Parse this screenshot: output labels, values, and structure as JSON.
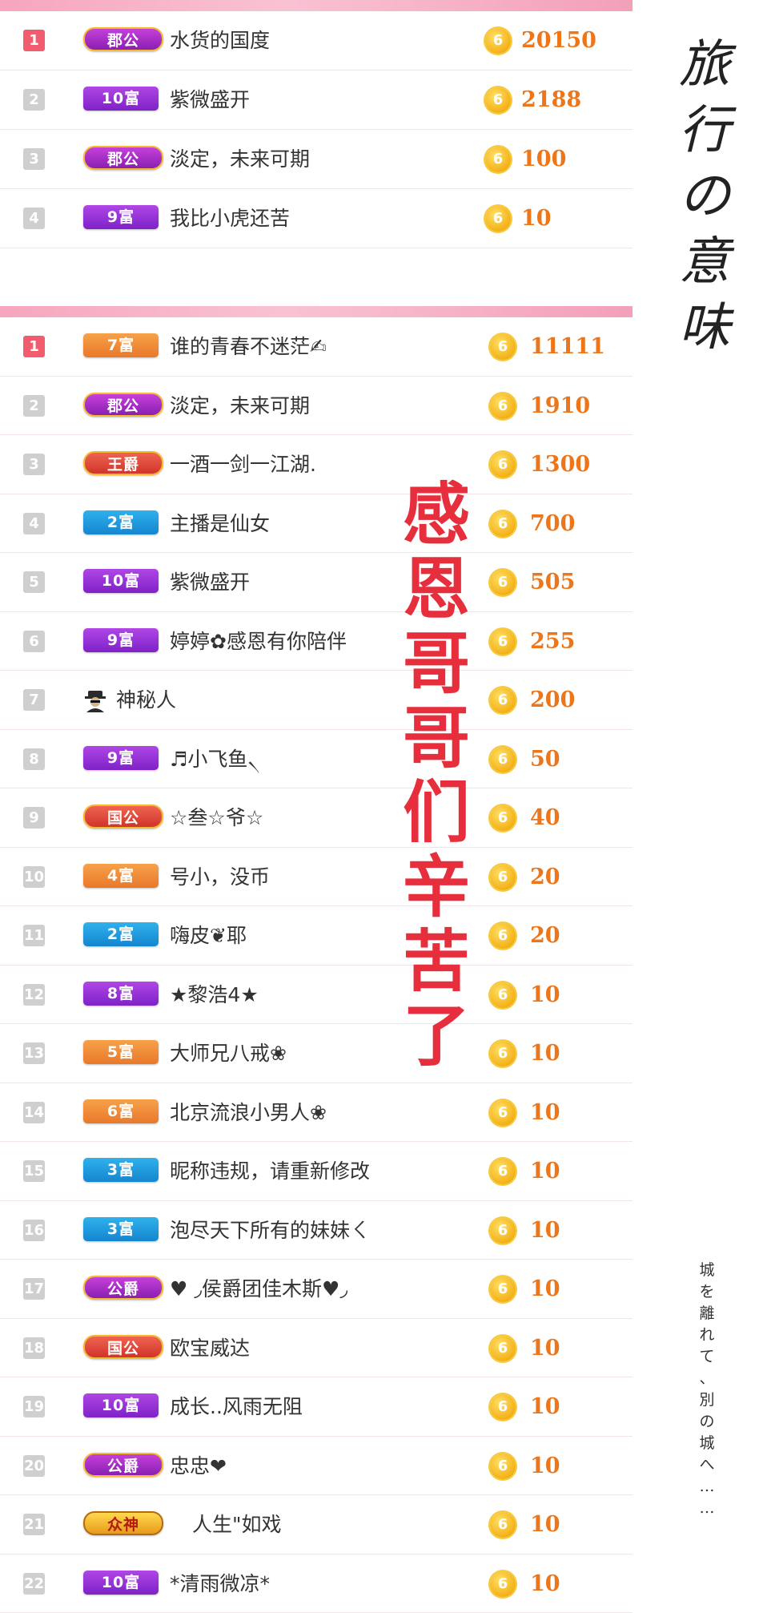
{
  "top_list": [
    {
      "rank": "1",
      "badge": "郡公",
      "badge_style": "b-magenta",
      "wide": true,
      "name": "水货的国度",
      "coin": "6",
      "amount": "20150",
      "first": true
    },
    {
      "rank": "2",
      "badge": "10富",
      "badge_style": "b-purple",
      "wide": false,
      "name": "紫微盛开",
      "coin": "6",
      "amount": "2188"
    },
    {
      "rank": "3",
      "badge": "郡公",
      "badge_style": "b-magenta",
      "wide": true,
      "name": "淡定，未来可期",
      "coin": "6",
      "amount": "100"
    },
    {
      "rank": "4",
      "badge": "9富",
      "badge_style": "b-purple",
      "wide": false,
      "name": "我比小虎还苦",
      "coin": "6",
      "amount": "10"
    }
  ],
  "bottom_list": [
    {
      "rank": "1",
      "badge": "7富",
      "badge_style": "b-orange",
      "name": "谁的青春不迷茫✍",
      "coin": "6",
      "amount": "11111",
      "first": true
    },
    {
      "rank": "2",
      "badge": "郡公",
      "badge_style": "b-magenta",
      "wide": true,
      "name": "淡定，未来可期",
      "coin": "6",
      "amount": "1910"
    },
    {
      "rank": "3",
      "badge": "王爵",
      "badge_style": "b-red",
      "wide": true,
      "name": "一酒一剑一江湖.",
      "coin": "6",
      "amount": "1300"
    },
    {
      "rank": "4",
      "badge": "2富",
      "badge_style": "b-blue",
      "name": "主播是仙女",
      "coin": "6",
      "amount": "700"
    },
    {
      "rank": "5",
      "badge": "10富",
      "badge_style": "b-purple",
      "name": "紫微盛开",
      "coin": "6",
      "amount": "505"
    },
    {
      "rank": "6",
      "badge": "9富",
      "badge_style": "b-purple",
      "name": "婷婷✿感恩有你陪伴",
      "coin": "6",
      "amount": "255"
    },
    {
      "rank": "7",
      "badge": "",
      "mystery": true,
      "name": "神秘人",
      "coin": "6",
      "amount": "200"
    },
    {
      "rank": "8",
      "badge": "9富",
      "badge_style": "b-purple",
      "name": "♬小飞鱼৲",
      "coin": "6",
      "amount": "50"
    },
    {
      "rank": "9",
      "badge": "国公",
      "badge_style": "b-red",
      "wide": true,
      "name": "☆叁☆爷☆",
      "coin": "6",
      "amount": "40"
    },
    {
      "rank": "10",
      "badge": "4富",
      "badge_style": "b-orange",
      "name": "号小，没币",
      "coin": "6",
      "amount": "20"
    },
    {
      "rank": "11",
      "badge": "2富",
      "badge_style": "b-blue",
      "name": "嗨皮❦耶",
      "coin": "6",
      "amount": "20"
    },
    {
      "rank": "12",
      "badge": "8富",
      "badge_style": "b-purple",
      "name": "★黎浩4★",
      "coin": "6",
      "amount": "10"
    },
    {
      "rank": "13",
      "badge": "5富",
      "badge_style": "b-orange",
      "name": "大师兄八戒❀",
      "coin": "6",
      "amount": "10"
    },
    {
      "rank": "14",
      "badge": "6富",
      "badge_style": "b-orange",
      "name": "北京流浪小男人❀",
      "coin": "6",
      "amount": "10"
    },
    {
      "rank": "15",
      "badge": "3富",
      "badge_style": "b-blue",
      "name": "昵称违规，请重新修改",
      "coin": "6",
      "amount": "10"
    },
    {
      "rank": "16",
      "badge": "3富",
      "badge_style": "b-blue",
      "name": "泡尽天下所有的妹妹ㄑ",
      "coin": "6",
      "amount": "10"
    },
    {
      "rank": "17",
      "badge": "公爵",
      "badge_style": "b-magenta",
      "wide": true,
      "name": "♥ ◞侯爵团佳木斯♥◞",
      "coin": "6",
      "amount": "10"
    },
    {
      "rank": "18",
      "badge": "国公",
      "badge_style": "b-red",
      "wide": true,
      "name": "欧宝威达",
      "coin": "6",
      "amount": "10"
    },
    {
      "rank": "19",
      "badge": "10富",
      "badge_style": "b-purple",
      "name": "成长..风雨无阻",
      "coin": "6",
      "amount": "10"
    },
    {
      "rank": "20",
      "badge": "公爵",
      "badge_style": "b-magenta",
      "wide": true,
      "name": "忠忠❤",
      "coin": "6",
      "amount": "10"
    },
    {
      "rank": "21",
      "badge": "众神",
      "badge_style": "b-gold",
      "wide": true,
      "shifted": true,
      "name": "人生\"如戏",
      "coin": "6",
      "amount": "10"
    },
    {
      "rank": "22",
      "badge": "10富",
      "badge_style": "b-purple",
      "name": "*清雨微凉*",
      "coin": "6",
      "amount": "10"
    }
  ],
  "overlay": [
    "感",
    "恩",
    "哥",
    "哥",
    "们",
    "辛",
    "苦",
    "了"
  ],
  "side_title": [
    "旅",
    "行",
    "の",
    "意",
    "味"
  ],
  "side_note": [
    "城",
    "を",
    "離",
    "れ",
    "て",
    "、",
    "別",
    "の",
    "城",
    "へ",
    "…",
    "…"
  ]
}
